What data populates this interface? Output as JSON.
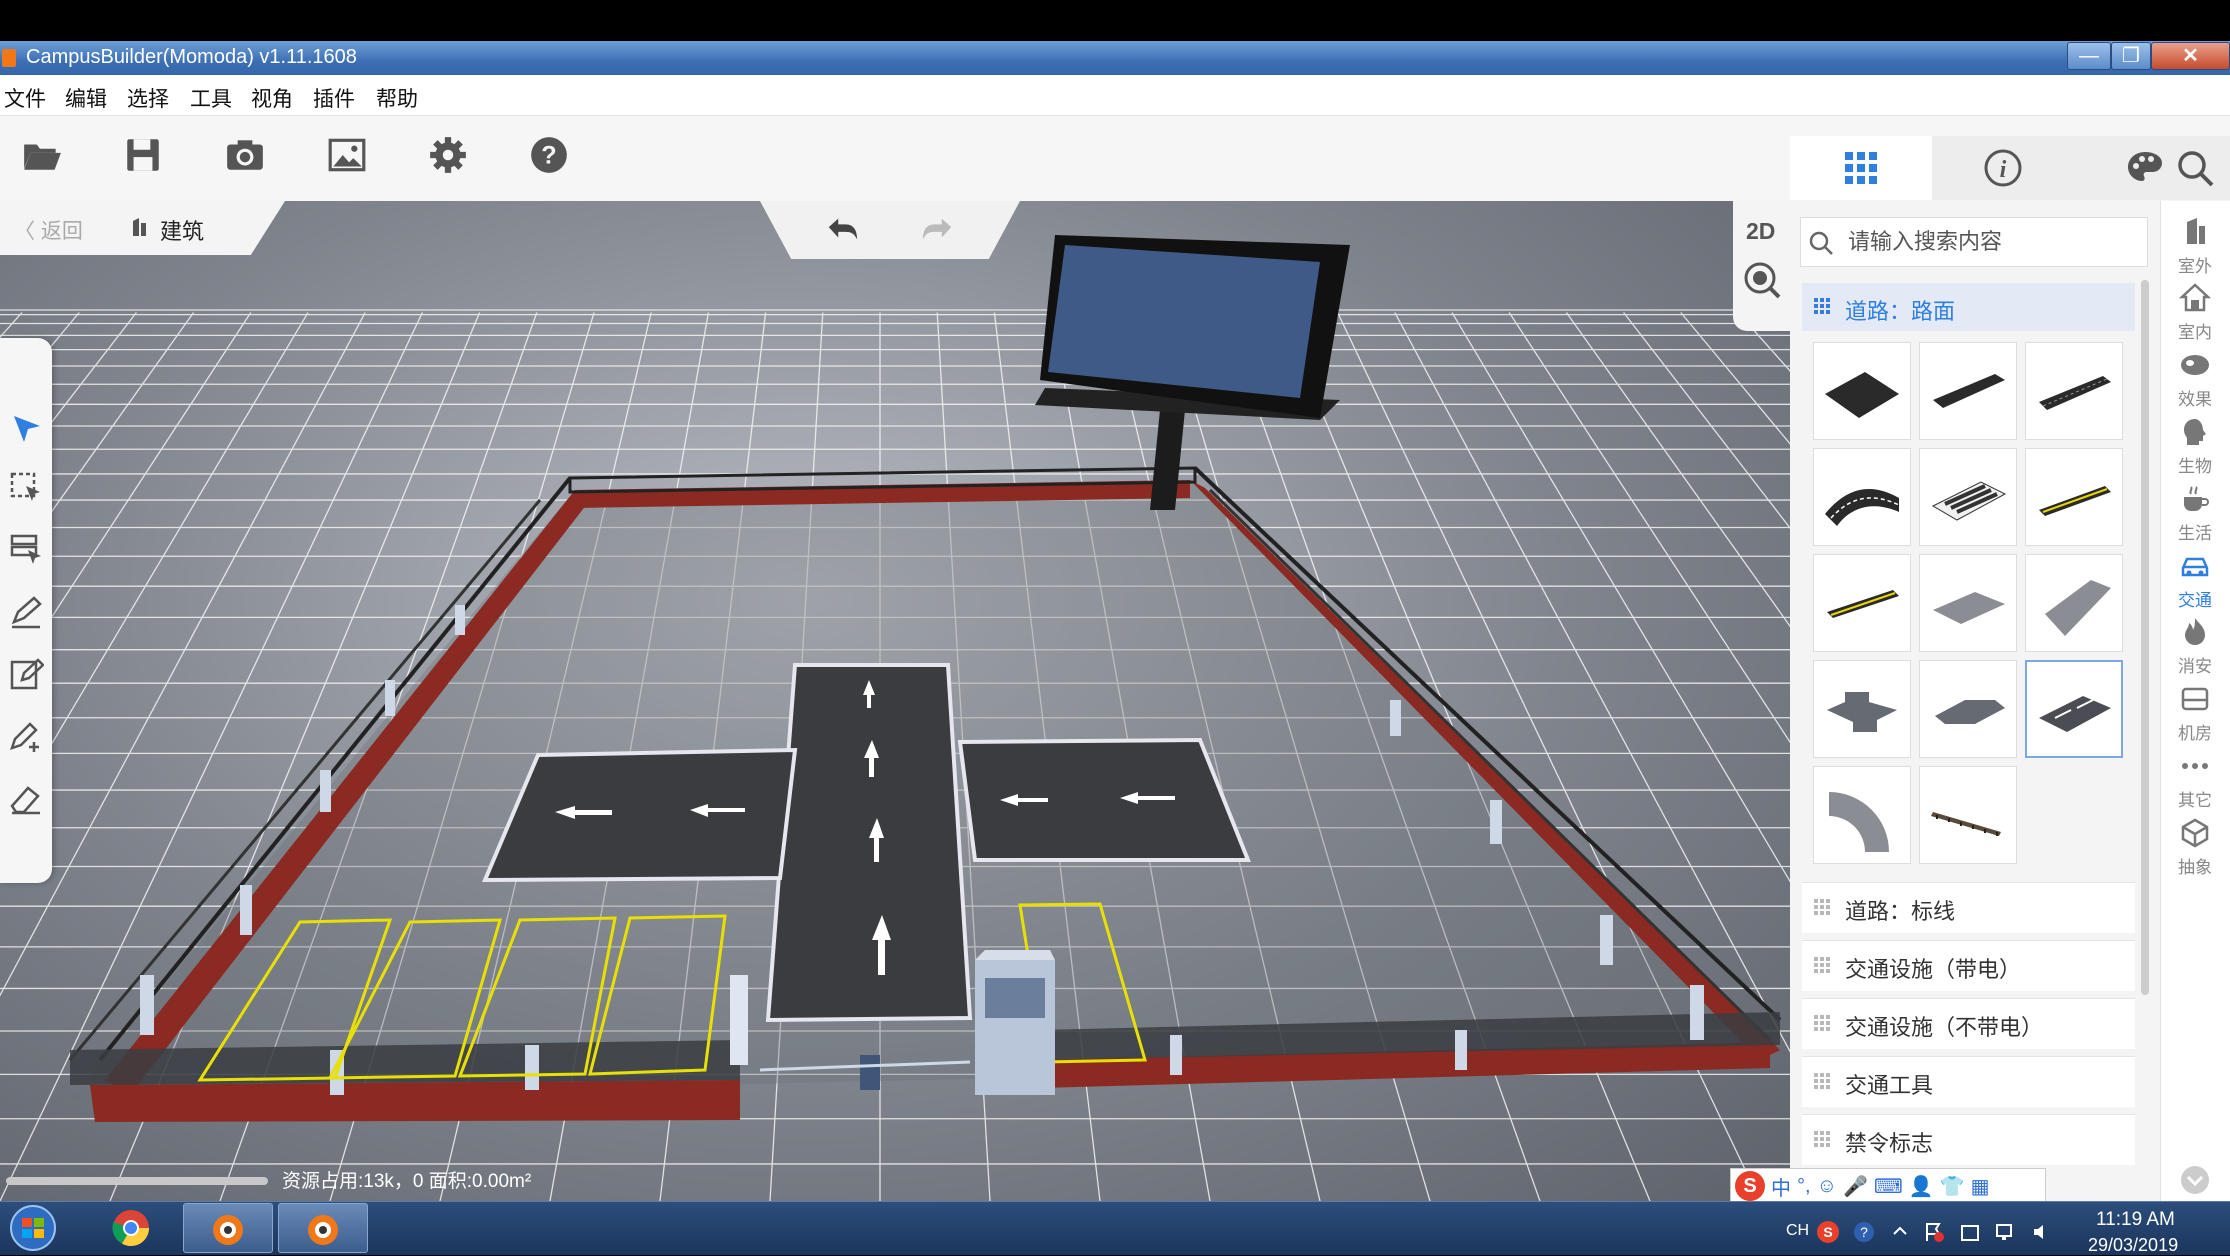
{
  "window": {
    "title": "CampusBuilder(Momoda) v1.11.1608",
    "min_symbol": "—",
    "max_symbol": "❐",
    "close_symbol": "✕"
  },
  "menu": [
    "文件",
    "编辑",
    "选择",
    "工具",
    "视角",
    "插件",
    "帮助"
  ],
  "toolbar": {
    "icons": [
      "folder-open-icon",
      "save-icon",
      "camera-icon",
      "image-icon",
      "gear-icon",
      "help-icon"
    ]
  },
  "right_tabs": [
    "grid-icon",
    "info-icon",
    "palette-icon",
    "search-icon"
  ],
  "breadcrumb": {
    "back": "〈 返回",
    "current": "建筑"
  },
  "view": {
    "mode_label": "2D"
  },
  "status": {
    "text": "资源占用:13k，0   面积:0.00m²"
  },
  "library": {
    "search_placeholder": "请输入搜索内容",
    "active_category": "道路：路面",
    "tile_count": 14,
    "categories": [
      "道路：标线",
      "交通设施（带电）",
      "交通设施（不带电）",
      "交通工具",
      "禁令标志"
    ]
  },
  "side_categories": [
    {
      "label": "室外",
      "icon": "building-icon"
    },
    {
      "label": "室内",
      "icon": "home-icon"
    },
    {
      "label": "效果",
      "icon": "effect-icon"
    },
    {
      "label": "生物",
      "icon": "head-icon"
    },
    {
      "label": "生活",
      "icon": "cup-icon"
    },
    {
      "label": "交通",
      "icon": "car-icon",
      "active": true
    },
    {
      "label": "消安",
      "icon": "fire-icon"
    },
    {
      "label": "机房",
      "icon": "server-icon"
    },
    {
      "label": "其它",
      "icon": "more-icon"
    },
    {
      "label": "抽象",
      "icon": "cube-icon"
    }
  ],
  "ime": {
    "items": [
      "中",
      "°,",
      "☺",
      "🎤",
      "⌨",
      "👤",
      "👕",
      "▦"
    ]
  },
  "taskbar": {
    "lang": "CH",
    "time": "11:19 AM",
    "date": "29/03/2019"
  },
  "colors": {
    "accent": "#2f7fe0",
    "ground_grid": "#ffffff",
    "wall": "#8a2a22",
    "parking_line": "#e8e000",
    "road": "#3a3c40"
  }
}
